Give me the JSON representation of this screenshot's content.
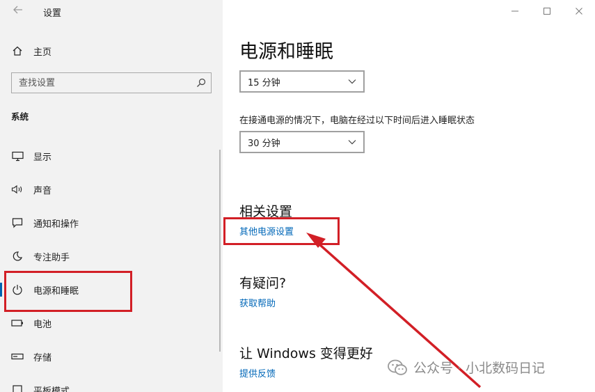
{
  "window": {
    "title": "设置",
    "back_icon": "back-arrow-icon"
  },
  "sidebar": {
    "home_label": "主页",
    "search_placeholder": "查找设置",
    "section_label": "系统",
    "items": [
      {
        "label": "显示",
        "icon": "display-icon",
        "active": false
      },
      {
        "label": "声音",
        "icon": "sound-icon",
        "active": false
      },
      {
        "label": "通知和操作",
        "icon": "notification-icon",
        "active": false
      },
      {
        "label": "专注助手",
        "icon": "focus-assist-icon",
        "active": false
      },
      {
        "label": "电源和睡眠",
        "icon": "power-icon",
        "active": true
      },
      {
        "label": "电池",
        "icon": "battery-icon",
        "active": false
      },
      {
        "label": "存储",
        "icon": "storage-icon",
        "active": false
      },
      {
        "label": "平板模式",
        "icon": "tablet-icon",
        "active": false
      }
    ]
  },
  "main": {
    "page_title": "电源和睡眠",
    "screen_dropdown_value": "15 分钟",
    "sleep_description": "在接通电源的情况下，电脑在经过以下时间后进入睡眠状态",
    "sleep_dropdown_value": "30 分钟",
    "related_settings_heading": "相关设置",
    "related_link": "其他电源设置",
    "questions_heading": "有疑问?",
    "help_link": "获取帮助",
    "improve_heading": "让 Windows 变得更好",
    "feedback_link": "提供反馈"
  },
  "watermark": {
    "text": "公众号 · 小北数码日记"
  },
  "colors": {
    "accent": "#0063b1",
    "link": "#0067b8",
    "annotation_red": "#d21f26",
    "sidebar_bg": "#f2f2f2"
  }
}
